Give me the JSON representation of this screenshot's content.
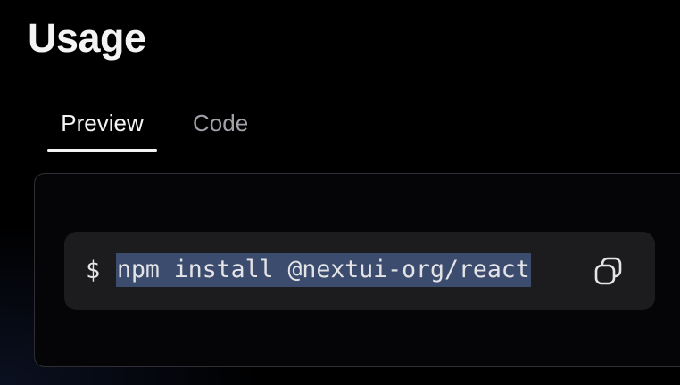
{
  "page": {
    "title": "Usage"
  },
  "tabs": [
    {
      "label": "Preview",
      "selected": true
    },
    {
      "label": "Code",
      "selected": false
    }
  ],
  "snippet": {
    "prompt": "$",
    "command": "npm install @nextui-org/react",
    "copy_icon": "copy-icon"
  },
  "colors": {
    "background": "#000000",
    "selection_highlight": "#3b4c6e",
    "snippet_background": "#1c1c1f",
    "active_tab": "#f4f4f5",
    "inactive_tab": "#a1a1aa"
  }
}
